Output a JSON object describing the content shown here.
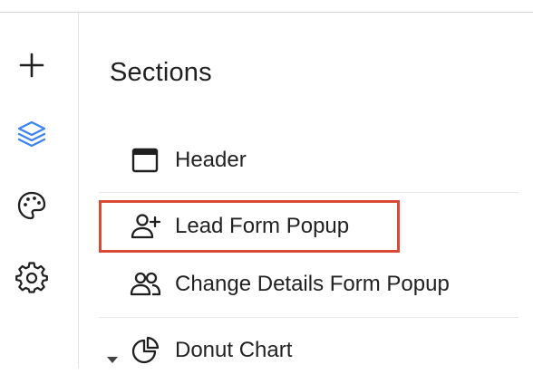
{
  "rail": {
    "items": [
      {
        "name": "add",
        "icon": "plus-icon"
      },
      {
        "name": "sections",
        "icon": "layers-icon",
        "active": true,
        "color": "#3b82f6"
      },
      {
        "name": "theme",
        "icon": "palette-icon"
      },
      {
        "name": "settings",
        "icon": "gear-icon"
      }
    ]
  },
  "panel": {
    "title": "Sections",
    "sections": [
      {
        "label": "Header",
        "icon": "browser-window-icon"
      },
      {
        "label": "Lead Form Popup",
        "icon": "user-plus-icon",
        "highlighted": true
      },
      {
        "label": "Change Details Form Popup",
        "icon": "users-icon"
      },
      {
        "label": "Donut Chart",
        "icon": "pie-chart-icon",
        "expandable": true
      }
    ]
  },
  "colors": {
    "accent": "#3b82f6",
    "highlight_border": "#d94a34",
    "text": "#1f1f1f"
  }
}
